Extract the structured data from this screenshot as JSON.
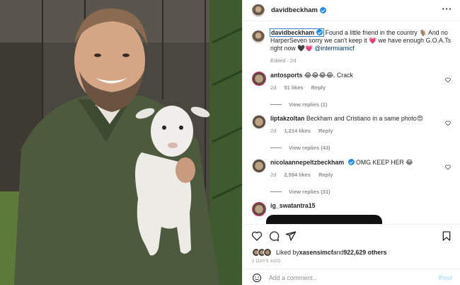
{
  "header": {
    "username": "davidbeckham",
    "more_icon": "more-horizontal-icon"
  },
  "caption": {
    "username": "davidbeckham",
    "text_before": "Found a little friend in the country 🐐 And no HarperSeven sorry we can't keep it 💗 we have enough G.O.A.Ts right now 🖤💗 ",
    "mention": "@intermiamicf",
    "meta": "Edited · 2d"
  },
  "comments": [
    {
      "username": "antosports",
      "text": "😂😂😂😂. Crack",
      "age": "2d",
      "likes": "51 likes",
      "reply": "Reply",
      "view_replies": "View replies (1)",
      "verified": false
    },
    {
      "username": "liptakzoltan",
      "text": "Beckham and Cristiano in a same photo😍",
      "age": "2d",
      "likes": "1,214 likes",
      "reply": "Reply",
      "view_replies": "View replies (43)",
      "verified": false
    },
    {
      "username": "nicolaannepeltzbeckham",
      "text": "OMG KEEP HER 😂",
      "age": "2d",
      "likes": "2,594 likes",
      "reply": "Reply",
      "view_replies": "View replies (31)",
      "verified": true
    },
    {
      "username": "ig_swatantra15",
      "text": ""
    }
  ],
  "actions": {
    "liked_by_prefix": "Liked by ",
    "liked_by_user": "xasensimcf",
    "liked_by_mid": " and ",
    "liked_by_count": "922,629 others",
    "time_ago": "2 DAYS AGO"
  },
  "add_comment": {
    "placeholder": "Add a comment...",
    "post_label": "Post"
  },
  "colors": {
    "link": "#00376b",
    "verified": "#1f8ef1",
    "post": "#b2dffc",
    "meta": "#8e8e8e"
  }
}
